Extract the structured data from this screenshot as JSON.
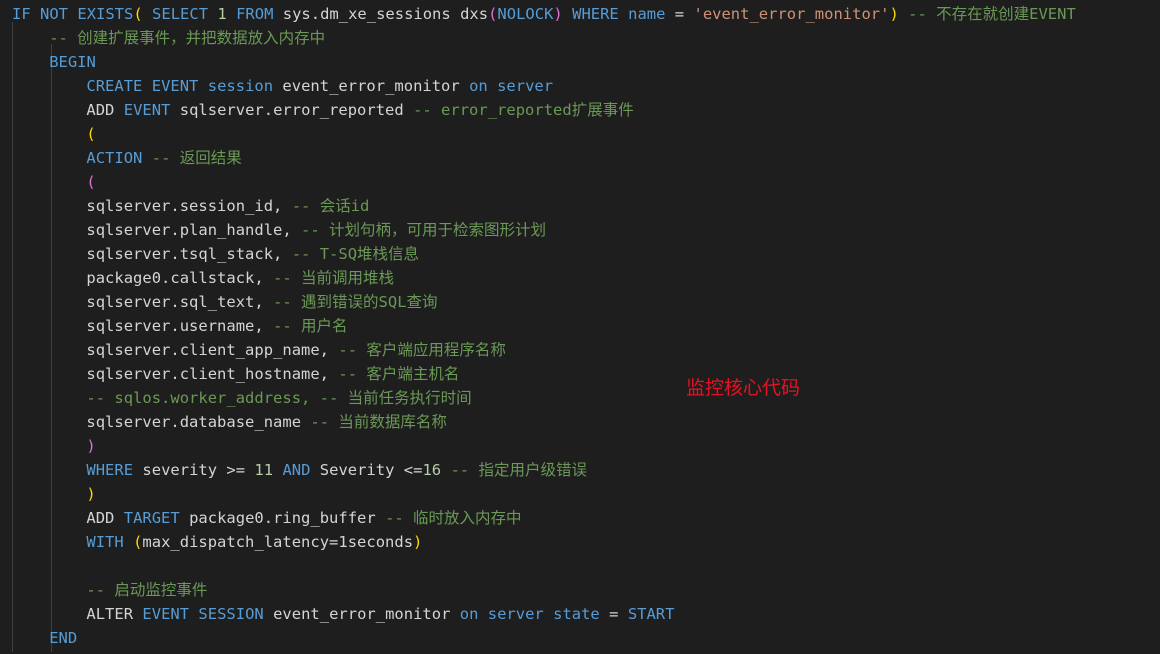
{
  "editor": {
    "background": "#1e1e1e",
    "language": "sql",
    "colors": {
      "keyword": "#569cd6",
      "identifier": "#d4d4d4",
      "comment": "#6a9955",
      "string": "#ce9178",
      "number": "#b5cea8",
      "bracket_level1": "#ffd700",
      "bracket_level2": "#da70d6",
      "annotation_red": "#e81123",
      "indent_guide": "#404040"
    }
  },
  "annotation": {
    "text": "监控核心代码",
    "color": "#e81123"
  },
  "lines": [
    {
      "n": 1,
      "indent": 0,
      "tokens": [
        {
          "t": "IF",
          "c": "kw"
        },
        {
          "t": " ",
          "c": "op"
        },
        {
          "t": "NOT",
          "c": "kw"
        },
        {
          "t": " ",
          "c": "op"
        },
        {
          "t": "EXISTS",
          "c": "kw"
        },
        {
          "t": "(",
          "c": "br-y"
        },
        {
          "t": " ",
          "c": "op"
        },
        {
          "t": "SELECT",
          "c": "kw"
        },
        {
          "t": " ",
          "c": "op"
        },
        {
          "t": "1",
          "c": "num"
        },
        {
          "t": " ",
          "c": "op"
        },
        {
          "t": "FROM",
          "c": "kw"
        },
        {
          "t": " ",
          "c": "op"
        },
        {
          "t": "sys.dm_xe_sessions",
          "c": "id"
        },
        {
          "t": " ",
          "c": "op"
        },
        {
          "t": "dxs",
          "c": "id"
        },
        {
          "t": "(",
          "c": "br-m"
        },
        {
          "t": "NOLOCK",
          "c": "kw"
        },
        {
          "t": ")",
          "c": "br-m"
        },
        {
          "t": " ",
          "c": "op"
        },
        {
          "t": "WHERE",
          "c": "kw"
        },
        {
          "t": " ",
          "c": "op"
        },
        {
          "t": "name",
          "c": "kw"
        },
        {
          "t": " ",
          "c": "op"
        },
        {
          "t": "=",
          "c": "op"
        },
        {
          "t": " ",
          "c": "op"
        },
        {
          "t": "'event_error_monitor'",
          "c": "str"
        },
        {
          "t": ")",
          "c": "br-y"
        },
        {
          "t": " ",
          "c": "op"
        },
        {
          "t": "-- 不存在就创建EVENT",
          "c": "cmt"
        }
      ]
    },
    {
      "n": 2,
      "indent": 4,
      "tokens": [
        {
          "t": "-- 创建扩展事件，并把数据放入内存中",
          "c": "cmt"
        }
      ]
    },
    {
      "n": 3,
      "indent": 4,
      "tokens": [
        {
          "t": "BEGIN",
          "c": "kw"
        }
      ]
    },
    {
      "n": 4,
      "indent": 8,
      "tokens": [
        {
          "t": "CREATE",
          "c": "kw"
        },
        {
          "t": " ",
          "c": "op"
        },
        {
          "t": "EVENT",
          "c": "kw"
        },
        {
          "t": " ",
          "c": "op"
        },
        {
          "t": "session",
          "c": "kw"
        },
        {
          "t": " ",
          "c": "op"
        },
        {
          "t": "event_error_monitor",
          "c": "id"
        },
        {
          "t": " ",
          "c": "op"
        },
        {
          "t": "on",
          "c": "kw"
        },
        {
          "t": " ",
          "c": "op"
        },
        {
          "t": "server",
          "c": "kw"
        }
      ]
    },
    {
      "n": 5,
      "indent": 8,
      "tokens": [
        {
          "t": "ADD",
          "c": "id"
        },
        {
          "t": " ",
          "c": "op"
        },
        {
          "t": "EVENT",
          "c": "kw"
        },
        {
          "t": " ",
          "c": "op"
        },
        {
          "t": "sqlserver.error_reported",
          "c": "id"
        },
        {
          "t": " ",
          "c": "op"
        },
        {
          "t": "-- error_reported扩展事件",
          "c": "cmt"
        }
      ]
    },
    {
      "n": 6,
      "indent": 8,
      "tokens": [
        {
          "t": "(",
          "c": "br-y"
        }
      ]
    },
    {
      "n": 7,
      "indent": 8,
      "tokens": [
        {
          "t": "ACTION",
          "c": "kw"
        },
        {
          "t": " ",
          "c": "op"
        },
        {
          "t": "-- 返回结果",
          "c": "cmt"
        }
      ]
    },
    {
      "n": 8,
      "indent": 8,
      "tokens": [
        {
          "t": "(",
          "c": "br-m"
        }
      ]
    },
    {
      "n": 9,
      "indent": 8,
      "tokens": [
        {
          "t": "sqlserver.session_id,",
          "c": "id"
        },
        {
          "t": " ",
          "c": "op"
        },
        {
          "t": "-- 会话id",
          "c": "cmt"
        }
      ]
    },
    {
      "n": 10,
      "indent": 8,
      "tokens": [
        {
          "t": "sqlserver.plan_handle,",
          "c": "id"
        },
        {
          "t": " ",
          "c": "op"
        },
        {
          "t": "-- 计划句柄，可用于检索图形计划",
          "c": "cmt"
        }
      ]
    },
    {
      "n": 11,
      "indent": 8,
      "tokens": [
        {
          "t": "sqlserver.tsql_stack,",
          "c": "id"
        },
        {
          "t": " ",
          "c": "op"
        },
        {
          "t": "-- T-SQ堆栈信息",
          "c": "cmt"
        }
      ]
    },
    {
      "n": 12,
      "indent": 8,
      "tokens": [
        {
          "t": "package0.callstack,",
          "c": "id"
        },
        {
          "t": " ",
          "c": "op"
        },
        {
          "t": "-- 当前调用堆栈",
          "c": "cmt"
        }
      ]
    },
    {
      "n": 13,
      "indent": 8,
      "tokens": [
        {
          "t": "sqlserver.sql_text,",
          "c": "id"
        },
        {
          "t": " ",
          "c": "op"
        },
        {
          "t": "-- 遇到错误的SQL查询",
          "c": "cmt"
        }
      ]
    },
    {
      "n": 14,
      "indent": 8,
      "tokens": [
        {
          "t": "sqlserver.username,",
          "c": "id"
        },
        {
          "t": " ",
          "c": "op"
        },
        {
          "t": "-- 用户名",
          "c": "cmt"
        }
      ]
    },
    {
      "n": 15,
      "indent": 8,
      "tokens": [
        {
          "t": "sqlserver.client_app_name,",
          "c": "id"
        },
        {
          "t": " ",
          "c": "op"
        },
        {
          "t": "-- 客户端应用程序名称",
          "c": "cmt"
        }
      ]
    },
    {
      "n": 16,
      "indent": 8,
      "tokens": [
        {
          "t": "sqlserver.client_hostname,",
          "c": "id"
        },
        {
          "t": " ",
          "c": "op"
        },
        {
          "t": "-- 客户端主机名",
          "c": "cmt"
        }
      ]
    },
    {
      "n": 17,
      "indent": 8,
      "tokens": [
        {
          "t": "-- sqlos.worker_address, -- 当前任务执行时间",
          "c": "cmt"
        }
      ]
    },
    {
      "n": 18,
      "indent": 8,
      "tokens": [
        {
          "t": "sqlserver.database_name",
          "c": "id"
        },
        {
          "t": " ",
          "c": "op"
        },
        {
          "t": "-- 当前数据库名称",
          "c": "cmt"
        }
      ]
    },
    {
      "n": 19,
      "indent": 8,
      "tokens": [
        {
          "t": ")",
          "c": "br-m"
        }
      ]
    },
    {
      "n": 20,
      "indent": 8,
      "tokens": [
        {
          "t": "WHERE",
          "c": "kw"
        },
        {
          "t": " ",
          "c": "op"
        },
        {
          "t": "severity",
          "c": "id"
        },
        {
          "t": " ",
          "c": "op"
        },
        {
          "t": ">=",
          "c": "op"
        },
        {
          "t": " ",
          "c": "op"
        },
        {
          "t": "11",
          "c": "num"
        },
        {
          "t": " ",
          "c": "op"
        },
        {
          "t": "AND",
          "c": "kw"
        },
        {
          "t": " ",
          "c": "op"
        },
        {
          "t": "Severity",
          "c": "id"
        },
        {
          "t": " ",
          "c": "op"
        },
        {
          "t": "<=",
          "c": "op"
        },
        {
          "t": "16",
          "c": "num"
        },
        {
          "t": " ",
          "c": "op"
        },
        {
          "t": "-- 指定用户级错误",
          "c": "cmt"
        }
      ]
    },
    {
      "n": 21,
      "indent": 8,
      "tokens": [
        {
          "t": ")",
          "c": "br-y"
        }
      ]
    },
    {
      "n": 22,
      "indent": 8,
      "tokens": [
        {
          "t": "ADD",
          "c": "id"
        },
        {
          "t": " ",
          "c": "op"
        },
        {
          "t": "TARGET",
          "c": "kw"
        },
        {
          "t": " ",
          "c": "op"
        },
        {
          "t": "package0.ring_buffer",
          "c": "id"
        },
        {
          "t": " ",
          "c": "op"
        },
        {
          "t": "-- 临时放入内存中",
          "c": "cmt"
        }
      ]
    },
    {
      "n": 23,
      "indent": 8,
      "tokens": [
        {
          "t": "WITH",
          "c": "kw"
        },
        {
          "t": " ",
          "c": "op"
        },
        {
          "t": "(",
          "c": "br-y"
        },
        {
          "t": "max_dispatch_latency=1seconds",
          "c": "id"
        },
        {
          "t": ")",
          "c": "br-y"
        }
      ]
    },
    {
      "n": 24,
      "indent": 0,
      "tokens": []
    },
    {
      "n": 25,
      "indent": 8,
      "tokens": [
        {
          "t": "-- 启动监控事件",
          "c": "cmt"
        }
      ]
    },
    {
      "n": 26,
      "indent": 8,
      "tokens": [
        {
          "t": "ALTER",
          "c": "id"
        },
        {
          "t": " ",
          "c": "op"
        },
        {
          "t": "EVENT",
          "c": "kw"
        },
        {
          "t": " ",
          "c": "op"
        },
        {
          "t": "SESSION",
          "c": "kw"
        },
        {
          "t": " ",
          "c": "op"
        },
        {
          "t": "event_error_monitor",
          "c": "id"
        },
        {
          "t": " ",
          "c": "op"
        },
        {
          "t": "on",
          "c": "kw"
        },
        {
          "t": " ",
          "c": "op"
        },
        {
          "t": "server",
          "c": "kw"
        },
        {
          "t": " ",
          "c": "op"
        },
        {
          "t": "state",
          "c": "kw"
        },
        {
          "t": " ",
          "c": "op"
        },
        {
          "t": "=",
          "c": "op"
        },
        {
          "t": " ",
          "c": "op"
        },
        {
          "t": "START",
          "c": "kw"
        }
      ]
    },
    {
      "n": 27,
      "indent": 4,
      "tokens": [
        {
          "t": "END",
          "c": "kw"
        }
      ]
    }
  ]
}
